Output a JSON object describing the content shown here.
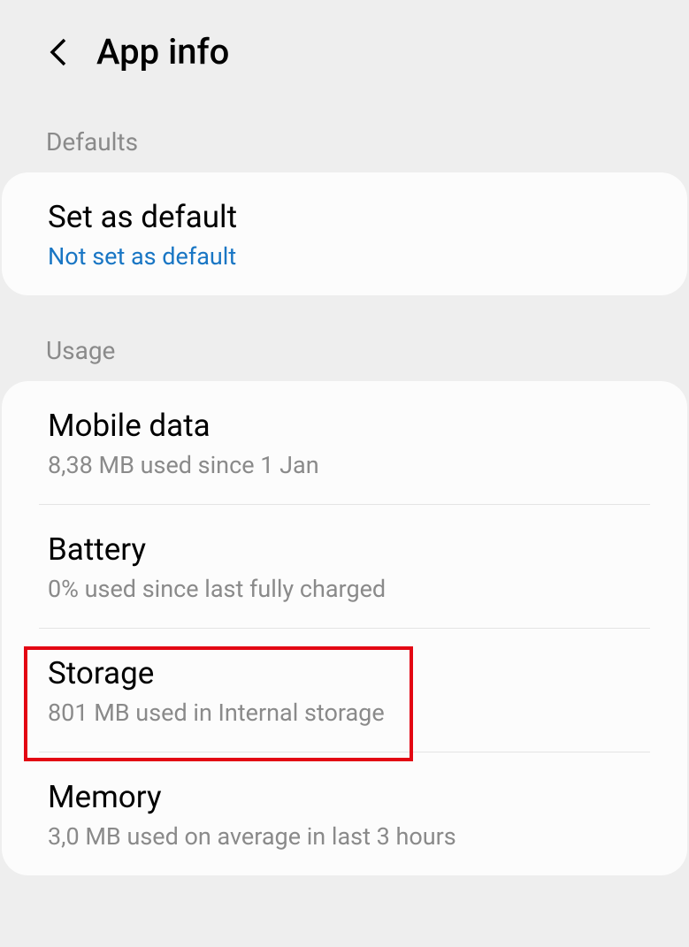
{
  "header": {
    "title": "App info"
  },
  "sections": {
    "defaults": {
      "header": "Defaults",
      "setAsDefault": {
        "title": "Set as default",
        "subtitle": "Not set as default"
      }
    },
    "usage": {
      "header": "Usage",
      "mobileData": {
        "title": "Mobile data",
        "subtitle": "8,38 MB used since 1 Jan"
      },
      "battery": {
        "title": "Battery",
        "subtitle": "0% used since last fully charged"
      },
      "storage": {
        "title": "Storage",
        "subtitle": "801 MB used in Internal storage"
      },
      "memory": {
        "title": "Memory",
        "subtitle": "3,0 MB used on average in last 3 hours"
      }
    }
  }
}
